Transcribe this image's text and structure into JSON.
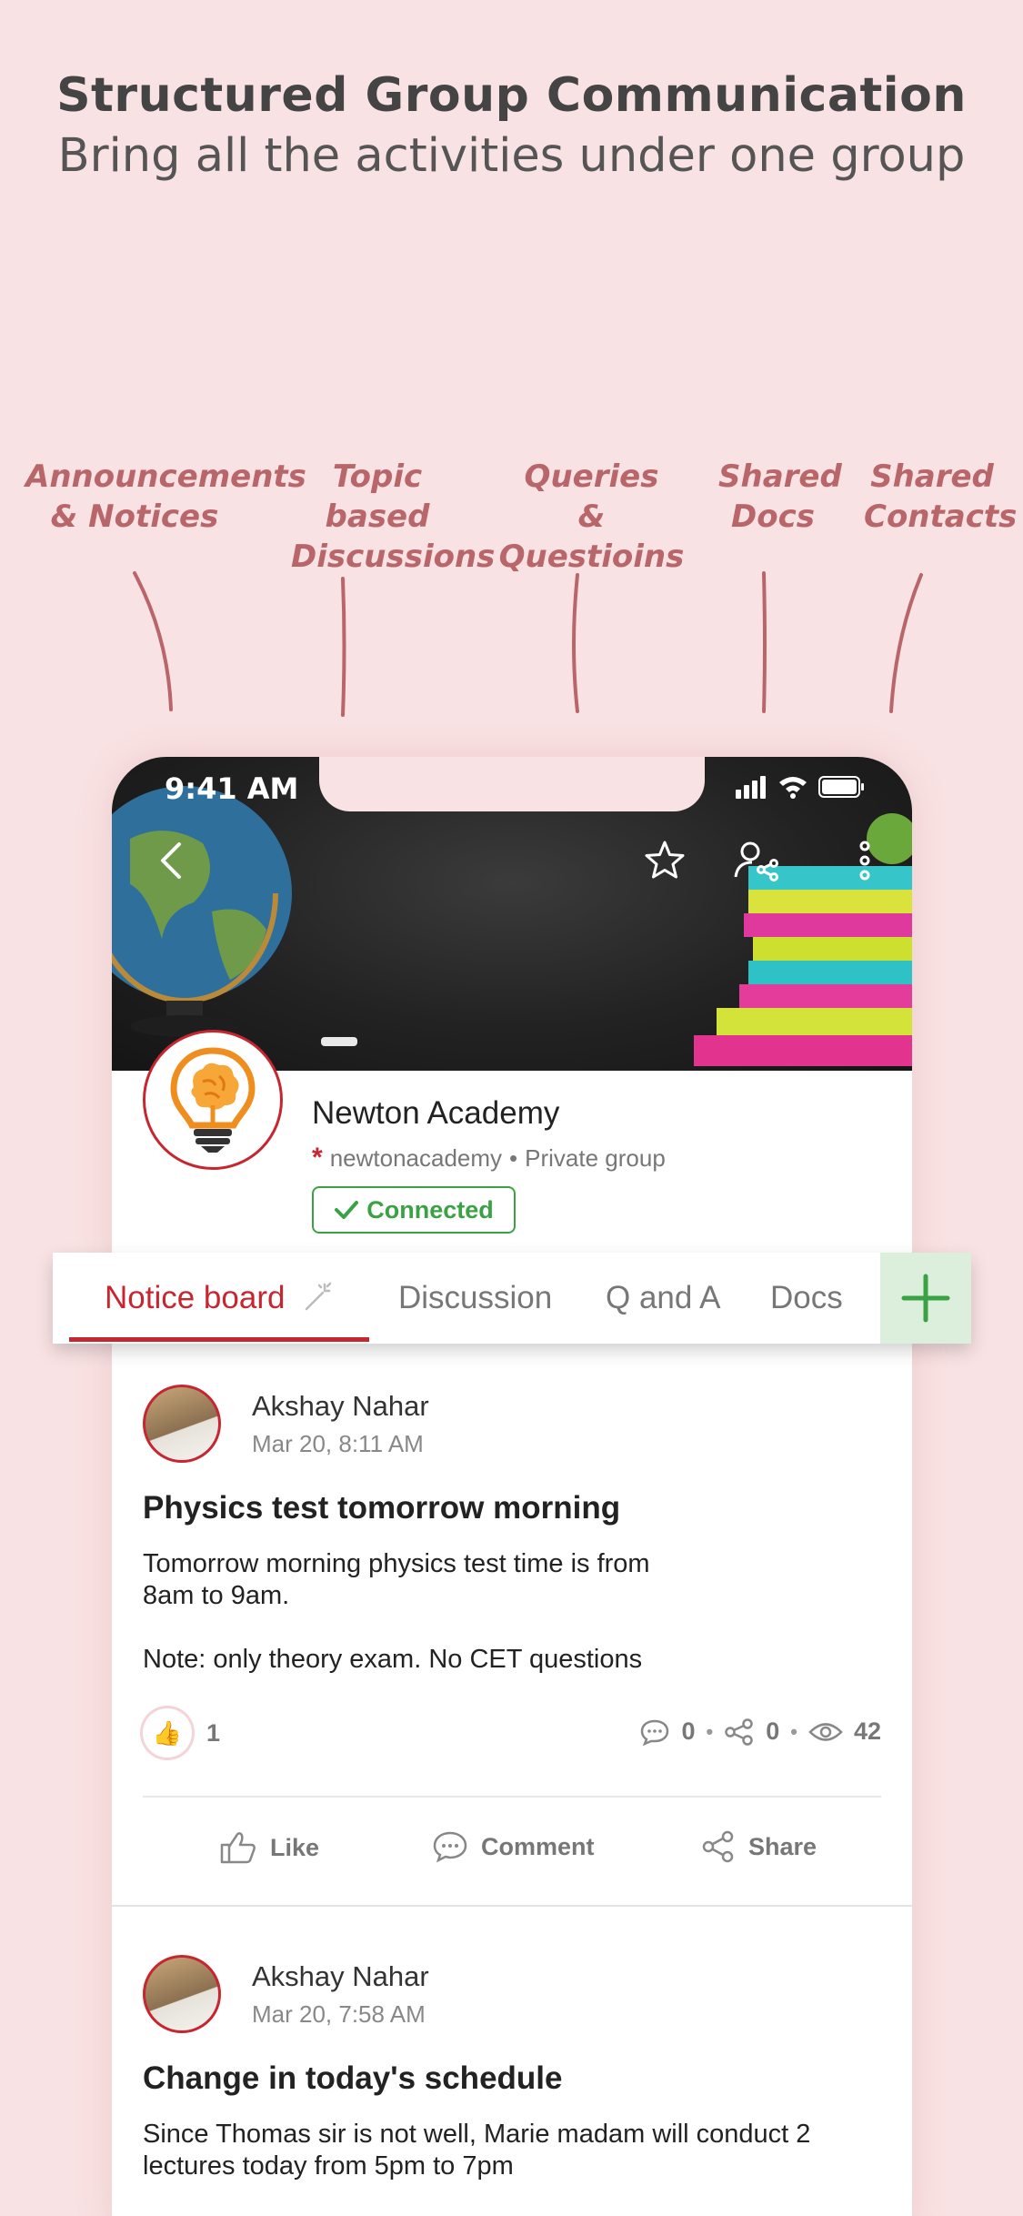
{
  "marketing": {
    "headline": "Structured Group Communication",
    "subline": "Bring all the activities under one group",
    "features": [
      {
        "line1": "Announcements",
        "line2": "& Notices"
      },
      {
        "line1": "Topic based",
        "line2": "Discussions"
      },
      {
        "line1": "Queries",
        "line2": "& Questioins"
      },
      {
        "line1": "Shared",
        "line2": "Docs"
      },
      {
        "line1": "Shared",
        "line2": "Contacts"
      }
    ]
  },
  "status_bar": {
    "time": "9:41 AM"
  },
  "group": {
    "name": "Newton Academy",
    "handle": "newtonacademy",
    "separator": "•",
    "privacy": "Private group",
    "connection_status": "Connected"
  },
  "tabs": [
    {
      "label": "Notice board",
      "active": true
    },
    {
      "label": "Discussion",
      "active": false
    },
    {
      "label": "Q and A",
      "active": false
    },
    {
      "label": "Docs",
      "active": false
    }
  ],
  "posts": [
    {
      "author": "Akshay Nahar",
      "time": "Mar 20, 8:11 AM",
      "title": "Physics test tomorrow morning",
      "body": "Tomorrow morning physics test time is from\n8am to 9am.\n\nNote: only theory exam. No CET questions",
      "likes": "1",
      "comments": "0",
      "shares": "0",
      "views": "42",
      "actions": {
        "like": "Like",
        "comment": "Comment",
        "share": "Share"
      }
    },
    {
      "author": "Akshay Nahar",
      "time": "Mar 20, 7:58 AM",
      "title": "Change in today's schedule",
      "body": "Since Thomas sir is not well, Marie madam will conduct 2\nlectures today from 5pm to 7pm"
    }
  ],
  "colors": {
    "accent": "#c62630",
    "connected": "#3aa245",
    "background": "#f9e2e3",
    "feature_label": "#b8666a"
  }
}
